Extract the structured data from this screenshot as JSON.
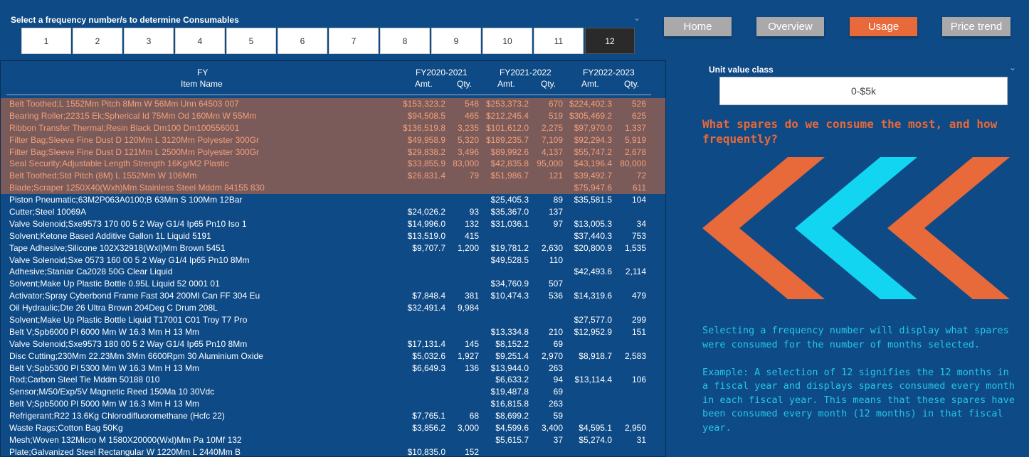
{
  "frequency": {
    "title": "Select a frequency number/s to determine Consumables",
    "options": [
      "1",
      "2",
      "3",
      "4",
      "5",
      "6",
      "7",
      "8",
      "9",
      "10",
      "11",
      "12"
    ],
    "selected": "12"
  },
  "nav": {
    "home": "Home",
    "overview": "Overview",
    "usage": "Usage",
    "price_trend": "Price trend"
  },
  "table": {
    "header": {
      "fy": "FY",
      "item_name": "Item Name",
      "fy1": "FY2020-2021",
      "fy2": "FY2021-2022",
      "fy3": "FY2022-2023",
      "amt": "Amt.",
      "qty": "Qty."
    },
    "rows": [
      {
        "name": "Belt Toothed;L 1552Mm Pitch 8Mm W 56Mm Unn 64503 007",
        "a1": "$153,323.2",
        "q1": "548",
        "a2": "$253,373.2",
        "q2": "670",
        "a3": "$224,402.3",
        "q3": "526",
        "hl": true
      },
      {
        "name": "Bearing Roller;22315 Ek;Spherical Id 75Mm Od 160Mm W 55Mm",
        "a1": "$94,508.5",
        "q1": "465",
        "a2": "$212,245.4",
        "q2": "519",
        "a3": "$305,469.2",
        "q3": "625",
        "hl": true
      },
      {
        "name": "Ribbon Transfer Thermal;Resin Black Dm100 Dm100556001",
        "a1": "$136,519.8",
        "q1": "3,235",
        "a2": "$101,612.0",
        "q2": "2,275",
        "a3": "$97,970.0",
        "q3": "1,337",
        "hl": true
      },
      {
        "name": "Filter Bag;Sleeve Fine Dust D 120Mm L 3120Mm Polyester 300Gr",
        "a1": "$49,958.9",
        "q1": "5,320",
        "a2": "$189,235.7",
        "q2": "7,109",
        "a3": "$92,294.3",
        "q3": "5,919",
        "hl": true
      },
      {
        "name": "Filter Bag;Sleeve Fine Dust D 121Mm L 2500Mm Polyester 300Gr",
        "a1": "$29,838.2",
        "q1": "3,496",
        "a2": "$89,992.6",
        "q2": "4,137",
        "a3": "$55,747.2",
        "q3": "2,678",
        "hl": true
      },
      {
        "name": "Seal Security;Adjustable Length Strength 16Kg/M2 Plastic",
        "a1": "$33,855.9",
        "q1": "83,000",
        "a2": "$42,835.8",
        "q2": "95,000",
        "a3": "$43,196.4",
        "q3": "80,000",
        "hl": true
      },
      {
        "name": "Belt Toothed;Std Pitch (8M) L 1552Mm W 106Mm",
        "a1": "$26,831.4",
        "q1": "79",
        "a2": "$51,986.7",
        "q2": "121",
        "a3": "$39,492.7",
        "q3": "72",
        "hl": true
      },
      {
        "name": "Blade;Scraper 1250X40(Wxh)Mm Stainless Steel Mddm 84155 830",
        "a1": "",
        "q1": "",
        "a2": "",
        "q2": "",
        "a3": "$75,947.6",
        "q3": "611",
        "hl": true
      },
      {
        "name": "Piston Pneumatic;63M2P063A0100;B 63Mm S 100Mm 12Bar",
        "a1": "",
        "q1": "",
        "a2": "$25,405.3",
        "q2": "89",
        "a3": "$35,581.5",
        "q3": "104",
        "hl": false
      },
      {
        "name": "Cutter;Steel 10069A",
        "a1": "$24,026.2",
        "q1": "93",
        "a2": "$35,367.0",
        "q2": "137",
        "a3": "",
        "q3": "",
        "hl": false
      },
      {
        "name": "Valve Solenoid;Sxe9573 170 00 5 2 Way G1/4 Ip65 Pn10 Iso 1",
        "a1": "$14,996.0",
        "q1": "132",
        "a2": "$31,036.1",
        "q2": "97",
        "a3": "$13,005.3",
        "q3": "34",
        "hl": false
      },
      {
        "name": "Solvent;Ketone Based Additive Gallon 1L Liquid 5191",
        "a1": "$13,519.0",
        "q1": "415",
        "a2": "",
        "q2": "",
        "a3": "$37,440.3",
        "q3": "753",
        "hl": false
      },
      {
        "name": "Tape Adhesive;Silicone 102X32918(Wxl)Mm Brown 5451",
        "a1": "$9,707.7",
        "q1": "1,200",
        "a2": "$19,781.2",
        "q2": "2,630",
        "a3": "$20,800.9",
        "q3": "1,535",
        "hl": false
      },
      {
        "name": "Valve Solenoid;Sxe 0573 160 00 5 2 Way G1/4 Ip65 Pn10 8Mm",
        "a1": "",
        "q1": "",
        "a2": "$49,528.5",
        "q2": "110",
        "a3": "",
        "q3": "",
        "hl": false
      },
      {
        "name": "Adhesive;Staniar Ca2028 50G Clear Liquid",
        "a1": "",
        "q1": "",
        "a2": "",
        "q2": "",
        "a3": "$42,493.6",
        "q3": "2,114",
        "hl": false
      },
      {
        "name": "Solvent;Make Up Plastic Bottle 0.95L Liquid 52 0001 01",
        "a1": "",
        "q1": "",
        "a2": "$34,760.9",
        "q2": "507",
        "a3": "",
        "q3": "",
        "hl": false
      },
      {
        "name": "Activator;Spray Cyberbond Frame Fast 304 200Ml Can FF 304 Eu",
        "a1": "$7,848.4",
        "q1": "381",
        "a2": "$10,474.3",
        "q2": "536",
        "a3": "$14,319.6",
        "q3": "479",
        "hl": false
      },
      {
        "name": "Oil Hydraulic;Dte 26 Ultra Brown 204Deg C Drum 208L",
        "a1": "$32,491.4",
        "q1": "9,984",
        "a2": "",
        "q2": "",
        "a3": "",
        "q3": "",
        "hl": false
      },
      {
        "name": "Solvent;Make Up Plastic Bottle Liquid T17001 C01 Troy T7 Pro",
        "a1": "",
        "q1": "",
        "a2": "",
        "q2": "",
        "a3": "$27,577.0",
        "q3": "299",
        "hl": false
      },
      {
        "name": "Belt V;Spb6000 Pl 6000 Mm W 16.3 Mm H 13 Mm",
        "a1": "",
        "q1": "",
        "a2": "$13,334.8",
        "q2": "210",
        "a3": "$12,952.9",
        "q3": "151",
        "hl": false
      },
      {
        "name": "Valve Solenoid;Sxe9573 180 00 5 2 Way G1/4 Ip65 Pn10 8Mm",
        "a1": "$17,131.4",
        "q1": "145",
        "a2": "$8,152.2",
        "q2": "69",
        "a3": "",
        "q3": "",
        "hl": false
      },
      {
        "name": "Disc Cutting;230Mm 22.23Mm 3Mm 6600Rpm 30 Aluminium Oxide",
        "a1": "$5,032.6",
        "q1": "1,927",
        "a2": "$9,251.4",
        "q2": "2,970",
        "a3": "$8,918.7",
        "q3": "2,583",
        "hl": false
      },
      {
        "name": "Belt V;Spb5300 Pl 5300 Mm W 16.3 Mm H 13 Mm",
        "a1": "$6,649.3",
        "q1": "136",
        "a2": "$13,944.0",
        "q2": "263",
        "a3": "",
        "q3": "",
        "hl": false
      },
      {
        "name": "Rod;Carbon Steel Tie Mddm 50188 010",
        "a1": "",
        "q1": "",
        "a2": "$6,633.2",
        "q2": "94",
        "a3": "$13,114.4",
        "q3": "106",
        "hl": false
      },
      {
        "name": "Sensor;M/50/Exp/5V Magnetic Reed 150Ma 10 30Vdc",
        "a1": "",
        "q1": "",
        "a2": "$19,487.8",
        "q2": "69",
        "a3": "",
        "q3": "",
        "hl": false
      },
      {
        "name": "Belt V;Spb5000 Pl 5000 Mm W 16.3 Mm H 13 Mm",
        "a1": "",
        "q1": "",
        "a2": "$16,815.8",
        "q2": "263",
        "a3": "",
        "q3": "",
        "hl": false
      },
      {
        "name": "Refrigerant;R22 13.6Kg Chlorodifluoromethane (Hcfc 22)",
        "a1": "$7,765.1",
        "q1": "68",
        "a2": "$8,699.2",
        "q2": "59",
        "a3": "",
        "q3": "",
        "hl": false
      },
      {
        "name": "Waste Rags;Cotton Bag 50Kg",
        "a1": "$3,856.2",
        "q1": "3,000",
        "a2": "$4,599.6",
        "q2": "3,400",
        "a3": "$4,595.1",
        "q3": "2,950",
        "hl": false
      },
      {
        "name": "Mesh;Woven 132Micro M 1580X20000(Wxl)Mm Pa 10Mf 132",
        "a1": "",
        "q1": "",
        "a2": "$5,615.7",
        "q2": "37",
        "a3": "$5,274.0",
        "q3": "31",
        "hl": false
      },
      {
        "name": "Plate;Galvanized Steel Rectangular W 1220Mm L 2440Mm B",
        "a1": "$10,835.0",
        "q1": "152",
        "a2": "",
        "q2": "",
        "a3": "",
        "q3": "",
        "hl": false
      }
    ]
  },
  "unit_value": {
    "title": "Unit value class",
    "selected": "0-$5k"
  },
  "question": "What spares do we consume the most, and how frequently?",
  "description": {
    "p1": "Selecting a frequency number will display what spares were consumed for the number of months selected.",
    "p2": "Example: A selection of 12 signifies the 12 months in a fiscal year and displays spares consumed every month in each fiscal year. This means that these spares have been consumed every month (12 months) in that fiscal year."
  },
  "colors": {
    "background": "#0e4a86",
    "accent_orange": "#e8693a",
    "accent_cyan": "#25c6e8",
    "highlight_row": "#7b5a5a",
    "nav_gray": "#a9a9a9"
  }
}
